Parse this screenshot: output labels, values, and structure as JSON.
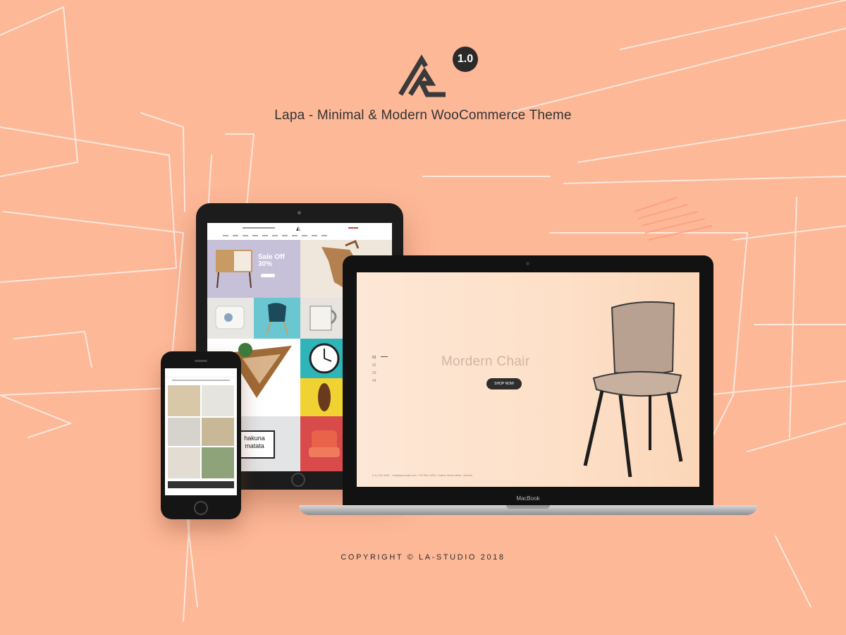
{
  "brand": {
    "version": "1.0",
    "title": "Lapa - Minimal & Modern WooCommerce Theme"
  },
  "laptop": {
    "device_label": "MacBook",
    "slide_title": "Mordern Chair",
    "shop_button": "SHOP NOW",
    "pager": [
      "01",
      "02",
      "03",
      "04"
    ],
    "footer": "(+1) 123 4567 · info@yourmail.com · PO Box 1622, Collins Street West, Victoria"
  },
  "tablet": {
    "sale_text": "Sale Off 30%",
    "poster_text": "hakuna matata"
  },
  "footer": {
    "copyright": "COPYRIGHT © LA-STUDIO 2018"
  },
  "colors": {
    "background": "#fdb898",
    "sketch": "#fff3ec",
    "accent_dark": "#2a2a2a"
  },
  "icons": [
    "lapa-logo-icon",
    "chair-icon"
  ]
}
